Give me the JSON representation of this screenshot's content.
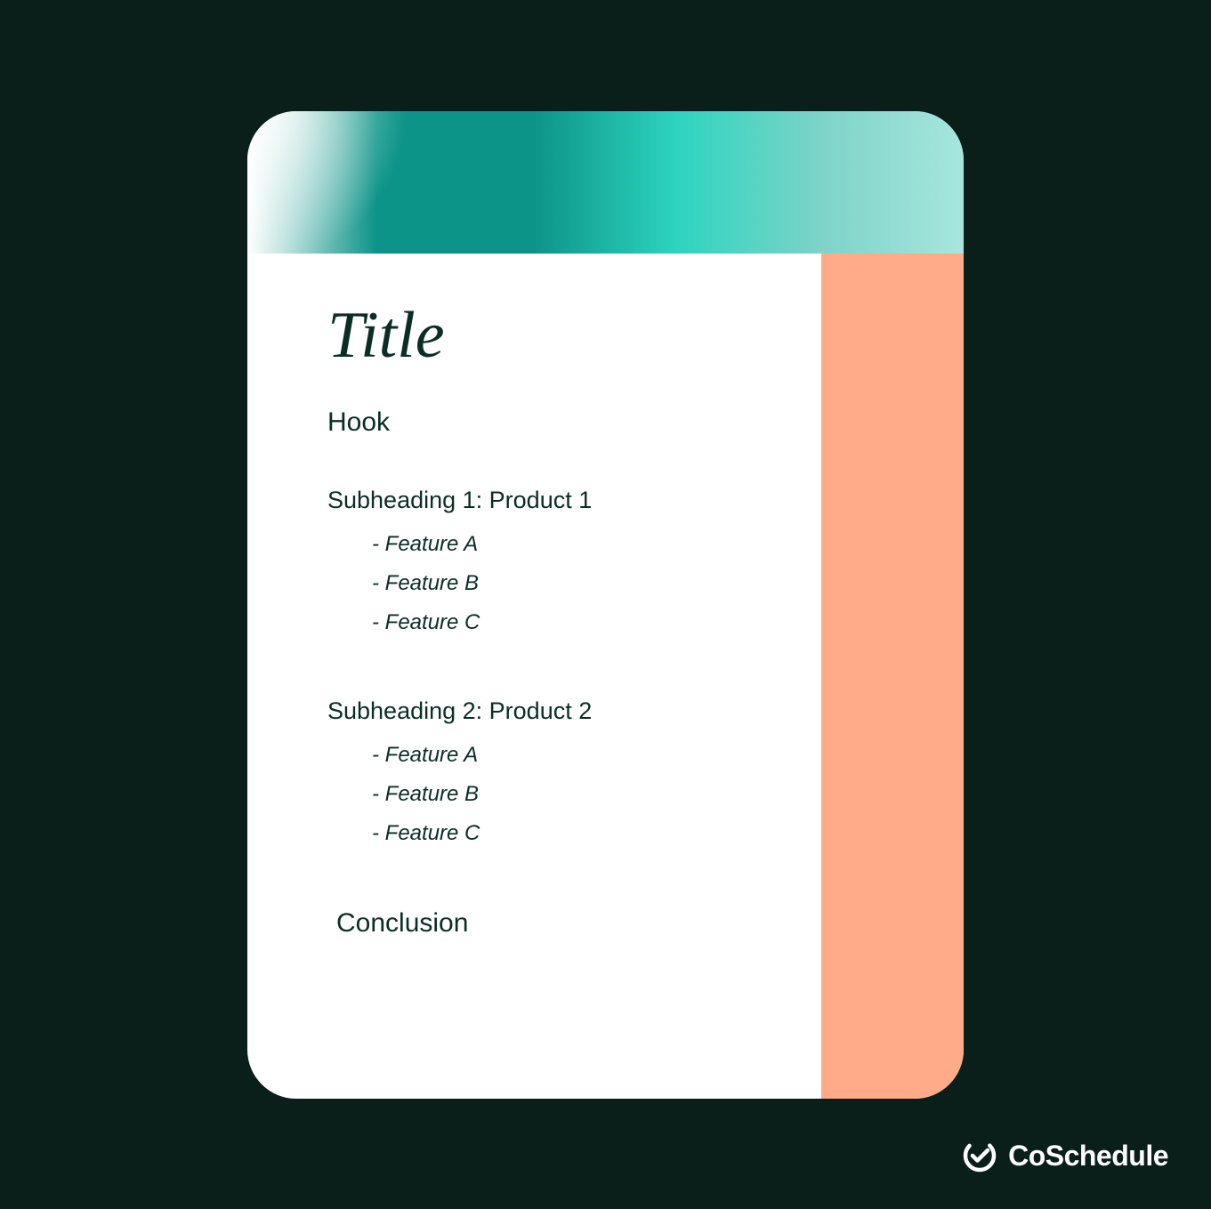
{
  "card": {
    "title": "Title",
    "hook": "Hook",
    "sections": [
      {
        "heading": "Subheading 1: Product 1",
        "features": [
          "Feature A",
          "Feature B",
          "Feature C"
        ]
      },
      {
        "heading": "Subheading 2: Product 2",
        "features": [
          "Feature A",
          "Feature B",
          "Feature C"
        ]
      }
    ],
    "conclusion": "Conclusion"
  },
  "brand": {
    "name": "CoSchedule"
  },
  "colors": {
    "background": "#0a1f1a",
    "accent_teal": "#0d9488",
    "accent_peach": "#ffab8a",
    "card_bg": "#ffffff"
  }
}
